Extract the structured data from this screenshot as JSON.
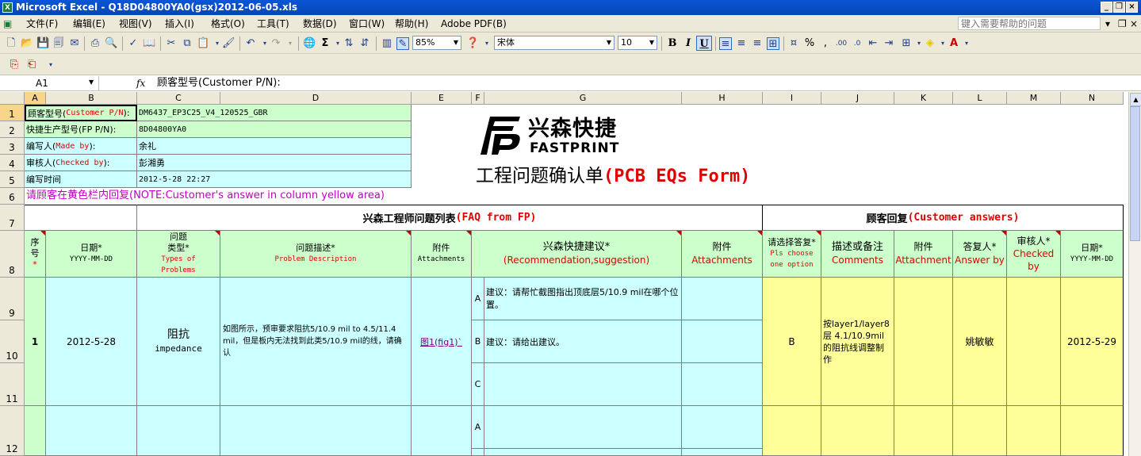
{
  "window": {
    "title": "Microsoft Excel - Q18D04800YA0(gsx)2012-06-05.xls"
  },
  "menu": [
    "文件(F)",
    "编辑(E)",
    "视图(V)",
    "插入(I)",
    "格式(O)",
    "工具(T)",
    "数据(D)",
    "窗口(W)",
    "帮助(H)",
    "Adobe PDF(B)"
  ],
  "help_placeholder": "键入需要帮助的问题",
  "toolbar": {
    "zoom": "85%",
    "font": "宋体",
    "font_size": "10"
  },
  "formula": {
    "name_box": "A1",
    "fx": "fx",
    "content": "顾客型号(Customer P/N):"
  },
  "columns": [
    "A",
    "B",
    "C",
    "D",
    "E",
    "F",
    "G",
    "H",
    "I",
    "J",
    "K",
    "L",
    "M",
    "N"
  ],
  "rows": [
    "1",
    "2",
    "3",
    "4",
    "5",
    "6",
    "7",
    "8",
    "9",
    "10",
    "11",
    "12"
  ],
  "info": [
    {
      "label_a": "顾客型号(",
      "label_b": "Customer P/N",
      "label_c": "):",
      "value": "DM6437_EP3C25_V4_120525_GBR"
    },
    {
      "label_a": "快捷生产型号(FP P/N):",
      "label_b": "",
      "label_c": "",
      "value": "8D04800YA0"
    },
    {
      "label_a": "编写人(",
      "label_b": "Made by",
      "label_c": "):",
      "value": "余礼"
    },
    {
      "label_a": "审核人(",
      "label_b": "Checked by",
      "label_c": "):",
      "value": "彭湘勇"
    },
    {
      "label_a": "编写时间",
      "label_b": "",
      "label_c": "",
      "value": "2012-5-28 22:27"
    }
  ],
  "logo": {
    "cn": "兴森快捷",
    "en": "FASTPRINT"
  },
  "form_title": {
    "cn": "工程问题确认单",
    "en": "(PCB EQs Form)"
  },
  "note": "请顾客在黄色栏内回复(NOTE:Customer's answer in column yellow area)",
  "sections": {
    "faq_cn": "兴森工程师问题列表",
    "faq_en": "(FAQ from FP)",
    "ans_cn": "顾客回复",
    "ans_en": "(Customer answers)"
  },
  "headers": {
    "seq": {
      "l1": "序",
      "l2": "号",
      "star": "*"
    },
    "date": {
      "l1": "日期*",
      "l2": "YYYY-MM-DD"
    },
    "type": {
      "l1": "问题",
      "l2": "类型*",
      "l3": "Types of",
      "l4": "Problems"
    },
    "desc": {
      "l1": "问题描述*",
      "l2": "Problem Description"
    },
    "att": {
      "l1": "附件",
      "l2": "Attachments"
    },
    "rec": {
      "l1": "兴森快捷建议*",
      "l2": "(Recommendation,suggestion)"
    },
    "att2": {
      "l1": "附件",
      "l2": "Attachments"
    },
    "choose": {
      "l1": "请选择答复*",
      "l2": "Pls choose",
      "l3": "one option"
    },
    "comments": {
      "l1": "描述或备注",
      "l2": "Comments"
    },
    "attach": {
      "l1": "附件",
      "l2": "Attachment"
    },
    "answer": {
      "l1": "答复人*",
      "l2": "Answer by"
    },
    "checked": {
      "l1": "审核人*",
      "l2": "Checked",
      "l3": "by"
    },
    "date2": {
      "l1": "日期*",
      "l2": "YYYY-MM-DD"
    }
  },
  "entry": {
    "seq": "1",
    "date": "2012-5-28",
    "type_cn": "阻抗",
    "type_en": "impedance",
    "desc": "如图所示，预审要求阻抗5/10.9 mil to 4.5/11.4 mil，但是板内无法找到此类5/10.9 mil的线，请确认",
    "attachment": "图1(fig1)`",
    "options": [
      {
        "letter": "A",
        "text": "建议：请帮忙截图指出顶底层5/10.9 mil在哪个位置。"
      },
      {
        "letter": "B",
        "text": "建议：请给出建议。"
      },
      {
        "letter": "C",
        "text": ""
      }
    ],
    "choice": "B",
    "comment": "按layer1/layer8层 4.1/10.9mil的阻抗线调整制作",
    "answer_by": "姚敏敏",
    "date2": "2012-5-29"
  },
  "entry2": {
    "first_option": "A"
  }
}
